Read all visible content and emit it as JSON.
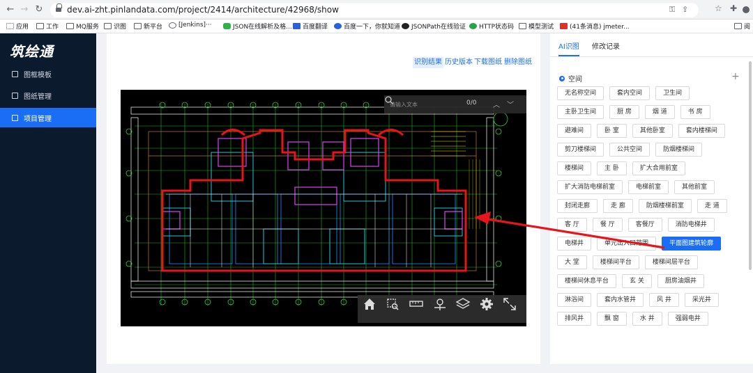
{
  "browser": {
    "url": "dev.ai-zht.pinlandata.com/project/2414/architecture/42968/show",
    "bookmarks": [
      "应用",
      "工作",
      "MQ服务",
      "识图",
      "新平台",
      "[Jenkins]···",
      "JSON在线解析及格...",
      "百度翻译",
      "百度一下，你就知道",
      "JSONPath在线验证",
      "HTTP状态码",
      "模型测试",
      "(41条消息) jmeter..."
    ],
    "reading_list_label": "阅"
  },
  "sidebar": {
    "logo": "筑绘通",
    "items": [
      {
        "label": "图框模板",
        "icon": "frame-icon",
        "active": false
      },
      {
        "label": "图纸管理",
        "icon": "drawing-icon",
        "active": false
      },
      {
        "label": "项目管理",
        "icon": "project-icon",
        "active": true
      }
    ]
  },
  "content": {
    "actions": [
      "识别结果",
      "历史版本",
      "下载图纸",
      "删除图纸"
    ],
    "selected_action": "识别结果",
    "search": {
      "placeholder": "请输入文本",
      "count": "0/0"
    },
    "toolbar": [
      "home-icon",
      "zoom-area-icon",
      "measure-icon",
      "locate-icon",
      "layers-icon",
      "settings-icon",
      "fullscreen-icon"
    ]
  },
  "right_panel": {
    "tabs": [
      {
        "label": "AI识图",
        "active": true
      },
      {
        "label": "修改记录",
        "active": false
      }
    ],
    "section_title": "空间",
    "tags": [
      [
        "无名称空间",
        "套内空间",
        "卫生间"
      ],
      [
        "主卧卫生间",
        "厨 房",
        "烟 道",
        "书 房"
      ],
      [
        "避难间",
        "卧 室",
        "其他卧室",
        "套内楼梯间"
      ],
      [
        "剪刀楼梯间",
        "公共空间",
        "防烟楼梯间"
      ],
      [
        "楼梯间",
        "主 卧",
        "扩大合用前室"
      ],
      [
        "扩大消防电梯前室",
        "电梯前室",
        "其他前室"
      ],
      [
        "封闭走廊",
        "走 廊",
        "防烟楼梯前室",
        "走 道"
      ],
      [
        "客 厅",
        "餐 厅",
        "客餐厅",
        "消防电梯井"
      ],
      [
        "电梯井",
        "单元出入口范围",
        "平面图建筑轮廓"
      ],
      [
        "大 堂",
        "楼梯间平台",
        "楼梯间层平台"
      ],
      [
        "楼梯间休息平台",
        "玄 关",
        "厨房油烟井"
      ],
      [
        "淋浴间",
        "套内水管井",
        "风 井",
        "采光井"
      ],
      [
        "排风井",
        "飘 窗",
        "水 井",
        "强弱电井"
      ]
    ],
    "selected_tag": "平面图建筑轮廓"
  },
  "colors": {
    "accent": "#1a6ef5",
    "sidebar_bg": "#0c1a2e",
    "annotation_arrow": "#e8141b"
  }
}
